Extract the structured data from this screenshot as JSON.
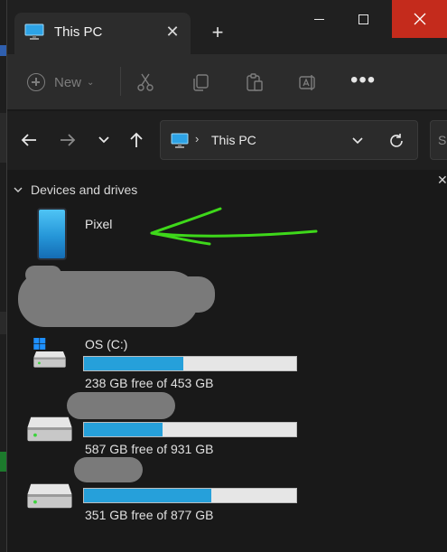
{
  "window": {
    "tab_title": "This PC",
    "tab_icon": "computer-icon",
    "close_tab_glyph": "✕",
    "new_tab_glyph": "+",
    "close_color": "#c42b1c"
  },
  "toolbar": {
    "new_label": "New",
    "icons": [
      "cut-icon",
      "copy-icon",
      "paste-icon",
      "rename-icon",
      "more-icon"
    ],
    "more_glyph": "•••"
  },
  "navigation": {
    "address_sep": "›",
    "address_text": "This PC",
    "search_placeholder": "S"
  },
  "content": {
    "group_label": "Devices and drives",
    "devices": [
      {
        "name": "Pixel",
        "icon": "phone-icon"
      }
    ],
    "drives": [
      {
        "name": "OS (C:)",
        "free_text": "238 GB free of 453 GB",
        "used_fraction": 0.47,
        "icon": "windows-drive-icon"
      },
      {
        "name": "",
        "free_text": "587 GB free of 931 GB",
        "used_fraction": 0.37,
        "icon": "drive-icon"
      },
      {
        "name": "",
        "free_text": "351 GB free of 877 GB",
        "used_fraction": 0.6,
        "icon": "drive-icon"
      }
    ]
  },
  "colors": {
    "accent": "#26a0da",
    "annotation_arrow": "#3ed81a",
    "redaction": "#7a7a7a"
  }
}
